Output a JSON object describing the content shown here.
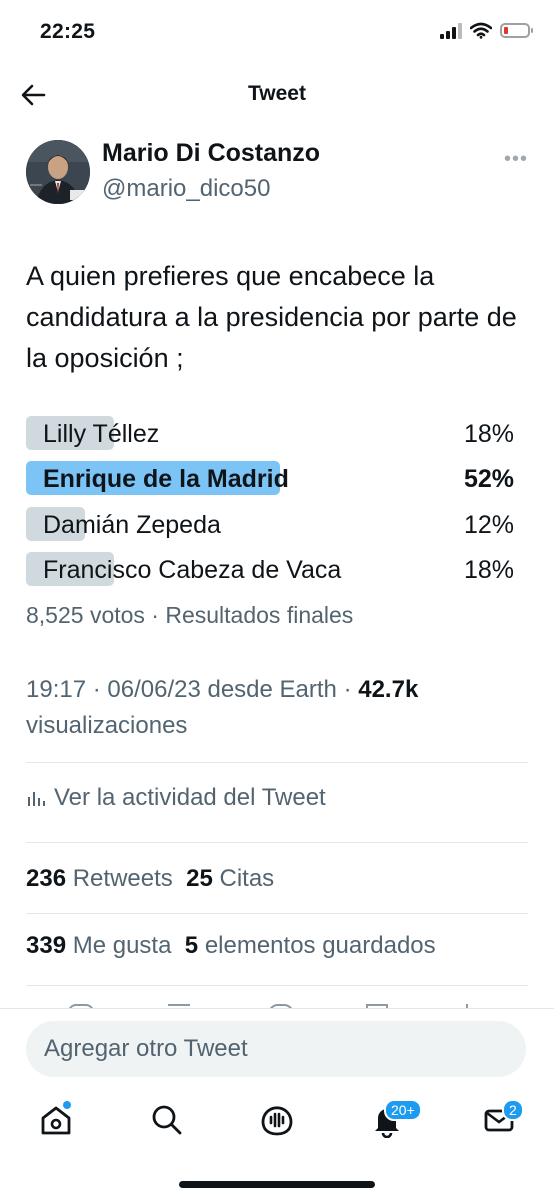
{
  "status_bar": {
    "time": "22:25"
  },
  "header": {
    "title": "Tweet"
  },
  "author": {
    "name": "Mario Di Costanzo",
    "handle": "@mario_dico50"
  },
  "tweet": {
    "text": "A quien prefieres que encabece la candidatura a la presidencia por parte de la oposición ;"
  },
  "poll": {
    "options": [
      {
        "label": "Lilly Téllez",
        "percent": "18%",
        "value": 18,
        "winner": false
      },
      {
        "label": "Enrique de la Madrid",
        "percent": "52%",
        "value": 52,
        "winner": true
      },
      {
        "label": "Damián Zepeda",
        "percent": "12%",
        "value": 12,
        "winner": false
      },
      {
        "label": "Francisco Cabeza de Vaca",
        "percent": "18%",
        "value": 18,
        "winner": false
      }
    ],
    "meta": "8,525 votos · Resultados finales"
  },
  "timestamp": {
    "text": "19:17 · 06/06/23 desde Earth · ",
    "views_count": "42.7k",
    "views_label": "visualizaciones"
  },
  "activity": {
    "label": "Ver la actividad del Tweet"
  },
  "stats": {
    "retweets_count": "236",
    "retweets_label": "Retweets",
    "quotes_count": "25",
    "quotes_label": "Citas",
    "likes_count": "339",
    "likes_label": "Me gusta",
    "bookmarks_count": "5",
    "bookmarks_label": "elementos guardados"
  },
  "reply": {
    "placeholder": "Agregar otro Tweet"
  },
  "nav": {
    "notifications_badge": "20+",
    "messages_badge": "2"
  },
  "colors": {
    "accent": "#1d9bf0",
    "poll_winner": "#7cc4f5",
    "poll_bar": "#cfd9de",
    "secondary_text": "#536471"
  }
}
